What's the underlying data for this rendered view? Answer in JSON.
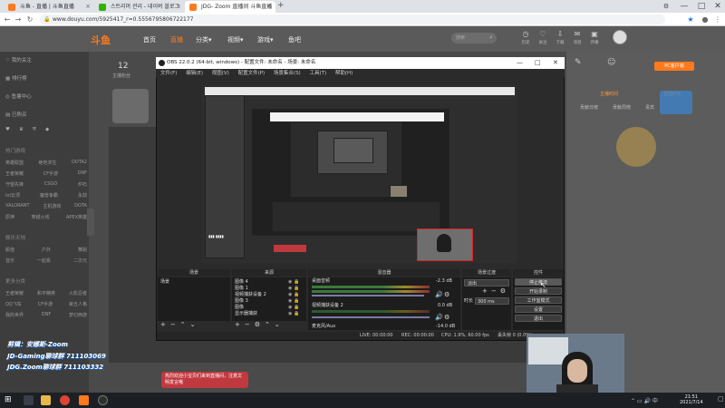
{
  "browser": {
    "tabs": [
      {
        "title": "斗鱼 - 直播 | 斗鱼直播",
        "favicon_color": "#ff7a1c",
        "active": false
      },
      {
        "title": "스트리머 관리 - 네이버 블로그",
        "favicon_color": "#2db400",
        "active": false
      },
      {
        "title": "JDG- Zoom 直播间 斗鱼直播",
        "favicon_color": "#ff7a1c",
        "active": true
      }
    ],
    "url": "www.douyu.com/5925417_r=0.5556795806722177",
    "new_tab": "+",
    "win_minimize": "—",
    "win_maximize": "□",
    "win_close": "✕"
  },
  "site": {
    "logo": "斗鱼",
    "nav": [
      "首页",
      "直播",
      "分类▾",
      "视频▾",
      "游戏▾",
      "鱼吧"
    ],
    "search_placeholder": "搜索",
    "header_icons": [
      "历史",
      "关注",
      "下载",
      "消息",
      "开播"
    ],
    "followers": "12",
    "followers_label": "主播粉丝",
    "sidebar": {
      "items": [
        "我的关注",
        "排行榜",
        "鱼塘中心",
        "已购买"
      ],
      "section_hot": "热门游戏",
      "hot_games": [
        [
          "英雄联盟",
          "绝地求生",
          "DOTA2"
        ],
        [
          "王者荣耀",
          "CF手游",
          "DNF"
        ],
        [
          "守望先锋",
          "CSGO",
          "炉石"
        ],
        [
          "lol云顶",
          "魔兽争霸",
          "永劫"
        ],
        [
          "VALORANT",
          "主机游戏",
          "DOTA"
        ],
        [
          "原神",
          "穿越火线",
          "APEX英雄"
        ]
      ],
      "section_ent": "娱乐天地",
      "ent_items": [
        [
          "颜值",
          "户外",
          "舞蹈"
        ],
        [
          "音乐",
          "一起看",
          "二次元"
        ]
      ],
      "section_more": "更多分类",
      "more_items": [
        [
          "王者荣耀",
          "和平精英",
          "火影忍者"
        ],
        [
          "QQ飞车",
          "CF手游",
          "第五人格"
        ],
        [
          "我的世界",
          "DNF",
          "梦幻西游"
        ]
      ]
    },
    "right_panel": {
      "pc_button": "PC客户端",
      "btn1": "主播时间",
      "btn2": "直播时长",
      "tabs": [
        "贡献日榜",
        "贡献周榜",
        "贵宾"
      ]
    },
    "chat_notice": "热烈欢迎小宝贝们来到直播间，注意文明发言哦"
  },
  "obs": {
    "title": "OBS 22.0.2 (64-bit, windows) - 配置文件: 未命名 - 场景: 未命名",
    "menu": [
      "文件(F)",
      "编辑(E)",
      "视图(V)",
      "配置文件(P)",
      "场景集合(S)",
      "工具(T)",
      "帮助(H)"
    ],
    "docks": {
      "scenes": {
        "header": "场景",
        "items": [
          "场景"
        ]
      },
      "sources": {
        "header": "来源",
        "items": [
          "图像 4",
          "图像 1",
          "视频捕获设备 2",
          "图像 3",
          "图像",
          "显示器捕获"
        ]
      },
      "mixer": {
        "header": "混音器",
        "channels": [
          {
            "name": "桌面音频",
            "db": "-2.3 dB"
          },
          {
            "name": "视频捕获设备 2",
            "db": "0.0 dB"
          },
          {
            "name": "麦克风/Aux",
            "db": "-14.0 dB"
          }
        ]
      },
      "transitions": {
        "header": "场景过渡",
        "type": "淡出",
        "duration_label": "时长",
        "duration": "300 ms"
      },
      "controls": {
        "header": "控件",
        "buttons": [
          "停止推流",
          "开始录制",
          "工作室模式",
          "设置",
          "退出"
        ]
      }
    },
    "status": {
      "live": "LIVE: 00:00:00",
      "rec": "REC: 00:00:00",
      "cpu": "CPU: 1.9%, 60.00 fps",
      "dropped": "丢失帧 0 (0.0%)"
    }
  },
  "overlay": {
    "line1": "剪辑：安娜斯-Zoom",
    "line2": "JD-Gaming聊球群  711103069",
    "line3": "JDG.Zoom聊球群  711103332",
    "line1_color": "#ffffff",
    "line2_color": "#ffd400",
    "accent_color": "#ff3b2f"
  },
  "taskbar": {
    "time": "21:51",
    "date": "2021/7/14"
  }
}
